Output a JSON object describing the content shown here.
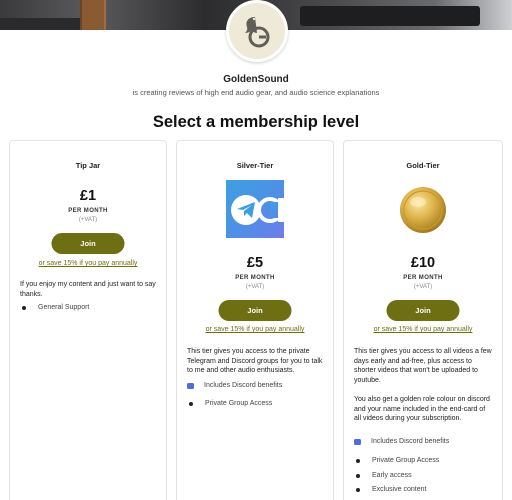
{
  "creator": {
    "name": "GoldenSound",
    "description": "is creating reviews of high end audio gear, and audio science explanations"
  },
  "page_title": "Select a membership level",
  "tiers": [
    {
      "name": "Tip Jar",
      "price": "£1",
      "period": "PER MONTH",
      "vat": "(+VAT)",
      "join_label": "Join",
      "annual_label": "or save 15% if you pay annually",
      "description": "If you enjoy my content and just want to say thanks.",
      "benefits": [
        "General Support"
      ]
    },
    {
      "name": "Silver-Tier",
      "price": "£5",
      "period": "PER MONTH",
      "vat": "(+VAT)",
      "join_label": "Join",
      "annual_label": "or save 15% if you pay annually",
      "description": "This tier gives you access to the private Telegram and Discord groups for you to talk to me and other audio enthusiasts.",
      "benefits": [
        "Includes Discord benefits",
        "Private Group Access"
      ]
    },
    {
      "name": "Gold-Tier",
      "price": "£10",
      "period": "PER MONTH",
      "vat": "(+VAT)",
      "join_label": "Join",
      "annual_label": "or save 15% if you pay annually",
      "description": "This tier gives you access to all videos a few days early and ad-free, plus access to shorter videos that won't be uploaded to youtube.",
      "description2": "You also get a golden role colour on discord and your name included in the end-card of all videos during your subscription.",
      "benefits": [
        "Includes Discord benefits",
        "Private Group Access",
        "Early access",
        "Exclusive content"
      ]
    }
  ],
  "colors": {
    "join_button": "#6e6e12",
    "annual_link": "#6e6e12",
    "discord_icon": "#4f6fd8"
  },
  "icons": {
    "avatar": "snail-g-logo-icon",
    "silver_tier": "telegram-discord-icon",
    "gold_tier": "gold-coin-icon",
    "discord_benefit": "discord-icon"
  }
}
